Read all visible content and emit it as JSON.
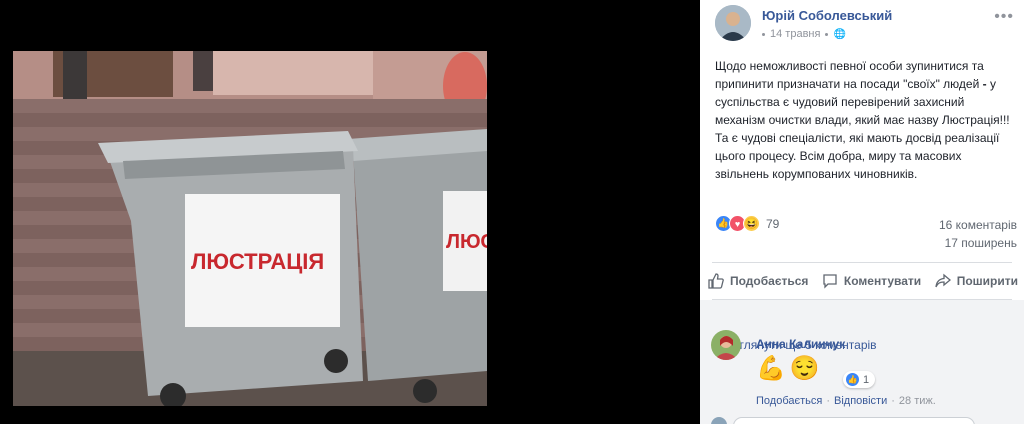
{
  "photo": {
    "sign_left": "ЛЮСТРАЦІЯ",
    "sign_right": "ЛЮСТ"
  },
  "post": {
    "author": "Юрій Соболевський",
    "date": "14 травня",
    "privacy_icon": "globe-icon",
    "more_icon": "ellipsis-icon",
    "text_part1": "Щодо неможливості певної особи зупинитися та припинити призначати на посади \"своїх\" людей ",
    "text_bold": "-",
    "text_part2": " у суспільства є чудовий перевірений захисний механізм очистки влади, який має назву Люстрація!!! Та є чудові спеціалісти, які мають досвід реалізації цього процесу. Всім добра, миру та масових звільнень корумпованих чиновників.",
    "reactions_count": "79",
    "comments_count": "16 коментарів",
    "shares_count": "17 поширень"
  },
  "actions": {
    "like": "Подобається",
    "comment": "Коментувати",
    "share": "Поширити"
  },
  "comments": {
    "view_more": "Переглянути ще 5 коментарів",
    "items": [
      {
        "author": "Анна Калинчук",
        "emoji1": "💪",
        "emoji2": "😌",
        "reaction_count": "1",
        "like_label": "Подобається",
        "reply_label": "Відповісти",
        "time": "28 тиж."
      }
    ]
  },
  "colors": {
    "link": "#385898",
    "muted": "#606770",
    "like": "#3b86f7",
    "love": "#f25268",
    "haha": "#fbcd4e"
  }
}
